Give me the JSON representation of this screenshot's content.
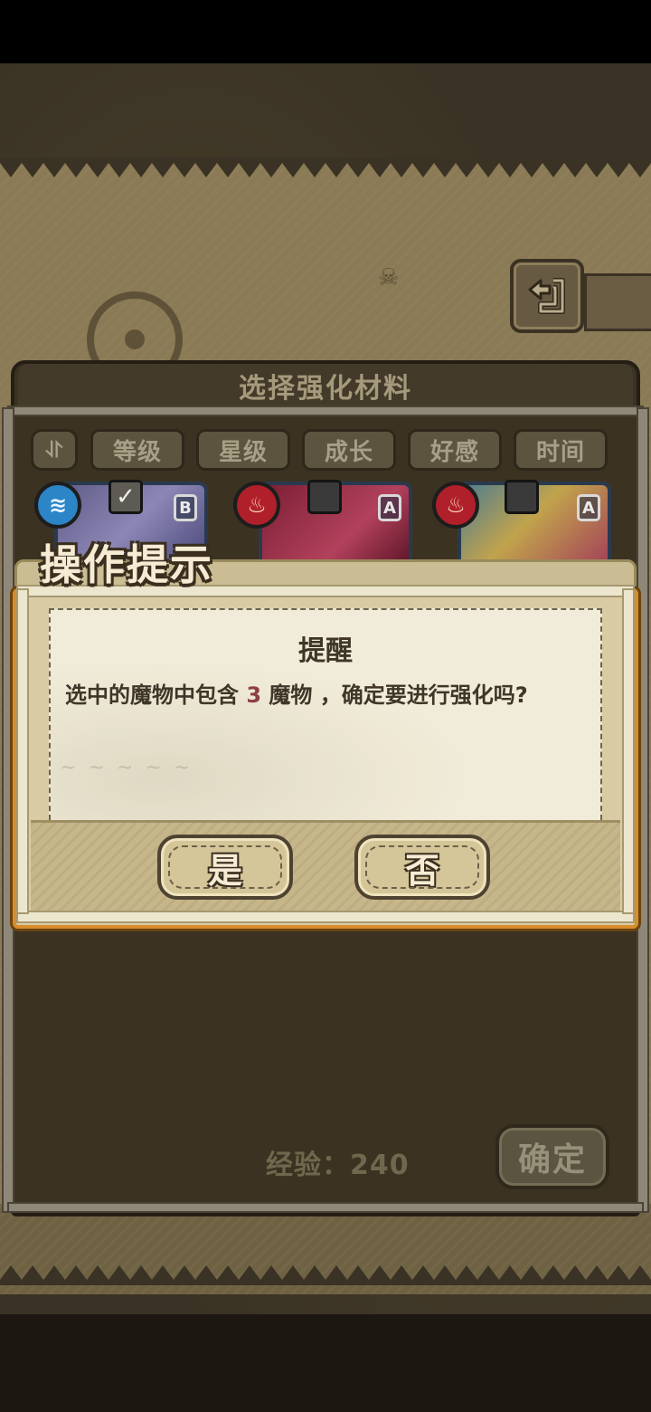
{
  "panel": {
    "title": "选择强化材料",
    "sort_toggle": "⥯",
    "tabs": [
      {
        "label": "等级"
      },
      {
        "label": "星级"
      },
      {
        "label": "成长"
      },
      {
        "label": "好感"
      },
      {
        "label": "时间"
      }
    ],
    "cards": [
      {
        "grade": "B",
        "element": "water",
        "element_symbol": "≋",
        "checked": true,
        "check_mark": "✓"
      },
      {
        "grade": "A",
        "element": "fire",
        "element_symbol": "♨",
        "checked": false,
        "check_mark": ""
      },
      {
        "grade": "A",
        "element": "fire",
        "element_symbol": "♨",
        "checked": false,
        "check_mark": ""
      }
    ],
    "exp_label": "经验：240",
    "confirm_label": "确定"
  },
  "back_button": {
    "icon": "back-arrow-icon",
    "glyph": "⮌"
  },
  "dialog": {
    "header": "操作提示",
    "title": "提醒",
    "message_prefix": "选中的魔物中包含 ",
    "message_count": "3",
    "message_suffix": " 魔物 ，确定要进行强化吗?",
    "yes_label": "是",
    "no_label": "否"
  },
  "colors": {
    "accent_orange": "#d88d2c",
    "highlight_number": "#8d3f45",
    "water_element": "#2b85c6",
    "fire_element": "#b0202a"
  }
}
